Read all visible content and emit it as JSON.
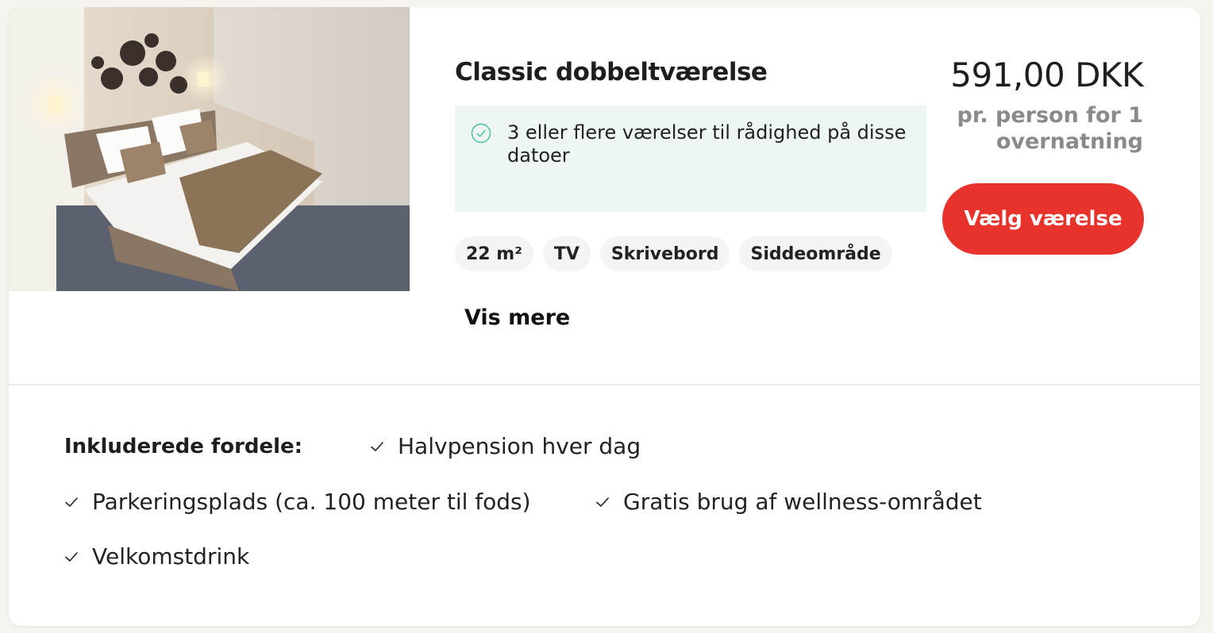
{
  "room": {
    "title": "Classic dobbeltværelse",
    "availability": "3 eller flere værelser til rådighed på disse datoer",
    "tags": [
      "22 m²",
      "TV",
      "Skrivebord",
      "Siddeområde"
    ],
    "show_more": "Vis mere"
  },
  "pricing": {
    "price": "591,00 DKK",
    "per_person": "pr. person for 1 overnatning",
    "select_label": "Vælg værelse",
    "button_color": "#e8332d"
  },
  "benefits": {
    "label": "Inkluderede fordele:",
    "items": [
      "Halvpension hver dag",
      "Parkeringsplads (ca. 100 meter til fods)",
      "Gratis brug af wellness-området",
      "Velkomstdrink"
    ]
  },
  "icons": {
    "availability": "check-circle-icon",
    "benefit": "checkmark-icon"
  }
}
